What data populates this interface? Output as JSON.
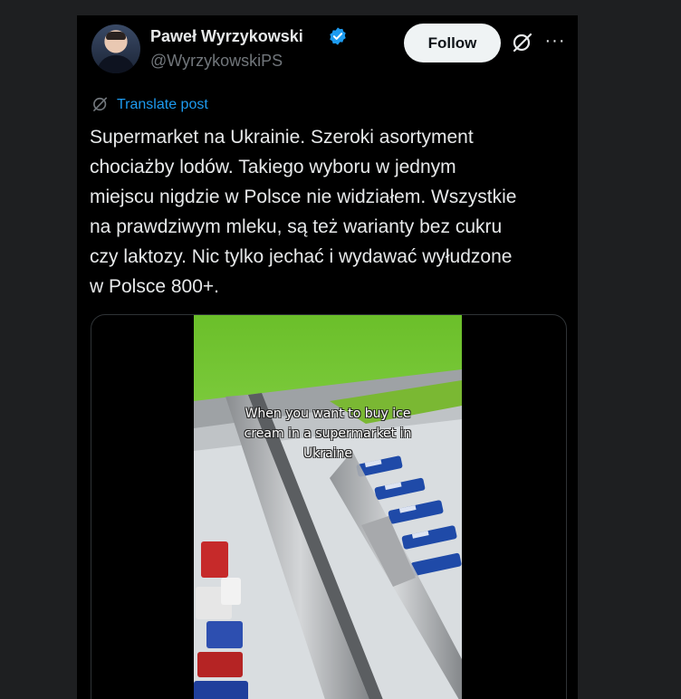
{
  "author": {
    "name": "Paweł Wyrzykowski",
    "handle": "@WyrzykowskiPS"
  },
  "actions": {
    "follow_label": "Follow",
    "more_label": "···"
  },
  "translate": {
    "label": "Translate post"
  },
  "post": {
    "text": "Supermarket na Ukrainie. Szeroki asortyment\nchociażby lodów. Takiego wyboru w jednym\nmiejscu nigdzie w Polsce nie widziałem. Wszystkie\nna prawdziwym mleku, są też warianty bez cukru\nczy laktozy. Nic tylko jechać i wydawać wyłudzone\nw Polsce 800+."
  },
  "media": {
    "overlay_caption": "When you want to buy ice\ncream in a supermarket in\nUkraine"
  },
  "colors": {
    "background": "#000000",
    "page_background": "#1e1f21",
    "link": "#1d9bf0",
    "verified": "#1d9bf0",
    "secondary_text": "#71767b",
    "follow_bg": "#eff3f4"
  },
  "icons": [
    "verified-badge-icon",
    "grok-icon",
    "more-options-icon",
    "translate-icon"
  ]
}
